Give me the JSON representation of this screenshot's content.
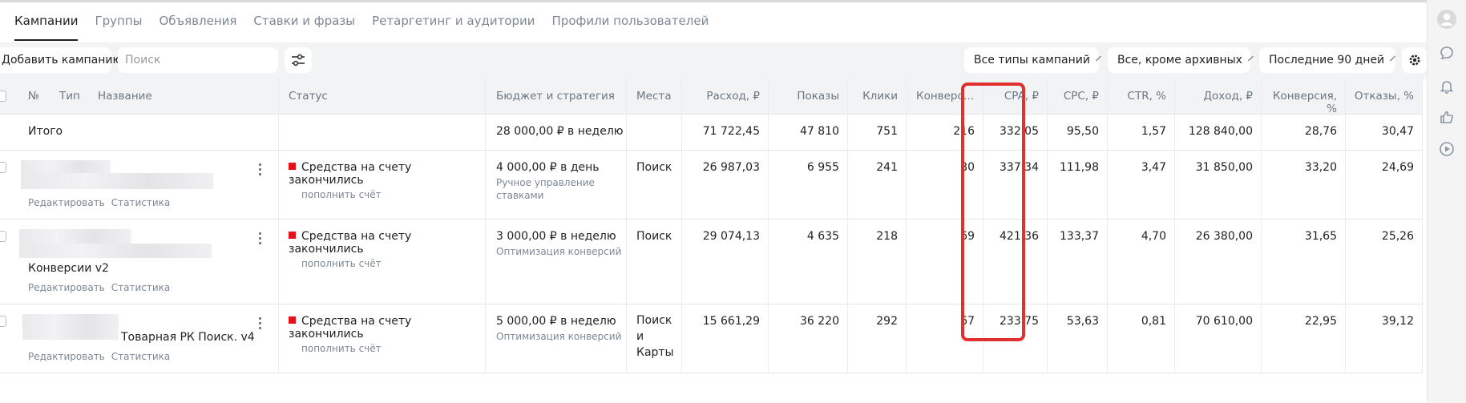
{
  "tabs": [
    "Кампании",
    "Группы",
    "Объявления",
    "Ставки и фразы",
    "Ретаргетинг и аудитории",
    "Профили пользователей"
  ],
  "toolbar": {
    "add_campaign": "Добавить кампанию",
    "search_placeholder": "Поиск",
    "campaign_types": "Все типы кампаний",
    "archive_filter": "Все, кроме архивных",
    "period": "Последние 90 дней"
  },
  "columns": {
    "num": "№",
    "type": "Тип",
    "name": "Название",
    "status": "Статус",
    "budget": "Бюджет и стратегия",
    "places": "Места",
    "cost": "Расход, ₽",
    "impressions": "Показы",
    "clicks": "Клики",
    "conversions": "Конверс…",
    "cpa": "CPA, ₽",
    "cpc": "CPC, ₽",
    "ctr": "CTR, %",
    "revenue": "Доход, ₽",
    "conv_rate": "Конверсия, %",
    "bounce": "Отказы, %"
  },
  "total": {
    "label": "Итого",
    "budget": "28 000,00 ₽ в неделю",
    "cost": "71 722,45",
    "impressions": "47 810",
    "clicks": "751",
    "conversions": "216",
    "cpa": "332,05",
    "cpc": "95,50",
    "ctr": "1,57",
    "revenue": "128 840,00",
    "conv_rate": "28,76",
    "bounce": "30,47"
  },
  "rows": [
    {
      "name": "",
      "status": "Средства на счету закончились",
      "status_action": "пополнить счёт",
      "budget": "4 000,00 ₽ в день",
      "strategy": "Ручное управление ставками",
      "places": "Поиск",
      "cost": "26 987,03",
      "impressions": "6 955",
      "clicks": "241",
      "conversions": "80",
      "cpa": "337,34",
      "cpc": "111,98",
      "ctr": "3,47",
      "revenue": "31 850,00",
      "conv_rate": "33,20",
      "bounce": "24,69",
      "edit": "Редактировать",
      "stats": "Статистика"
    },
    {
      "name": "Конверсии v2",
      "status": "Средства на счету закончились",
      "status_action": "пополнить счёт",
      "budget": "3 000,00 ₽ в неделю",
      "strategy": "Оптимизация конверсий",
      "places": "Поиск",
      "cost": "29 074,13",
      "impressions": "4 635",
      "clicks": "218",
      "conversions": "69",
      "cpa": "421,36",
      "cpc": "133,37",
      "ctr": "4,70",
      "revenue": "26 380,00",
      "conv_rate": "31,65",
      "bounce": "25,26",
      "edit": "Редактировать",
      "stats": "Статистика"
    },
    {
      "name": "Товарная РК Поиск. v4",
      "status": "Средства на счету закончились",
      "status_action": "пополнить счёт",
      "budget": "5 000,00 ₽ в неделю",
      "strategy": "Оптимизация конверсий",
      "places": "Поиск и Карты",
      "cost": "15 661,29",
      "impressions": "36 220",
      "clicks": "292",
      "conversions": "67",
      "cpa": "233,75",
      "cpc": "53,63",
      "ctr": "0,81",
      "revenue": "70 610,00",
      "conv_rate": "22,95",
      "bounce": "39,12",
      "edit": "Редактировать",
      "stats": "Статистика"
    }
  ],
  "colors": {
    "highlight": "#e2302e",
    "status_red": "#e0121a",
    "toolbar_bg": "#f2f3f5"
  },
  "icons": [
    "avatar-icon",
    "chat-icon",
    "bell-icon",
    "thumbs-up-icon",
    "play-icon",
    "filter-settings-icon",
    "gear-icon",
    "chevron-down-icon",
    "kebab-menu-icon"
  ]
}
